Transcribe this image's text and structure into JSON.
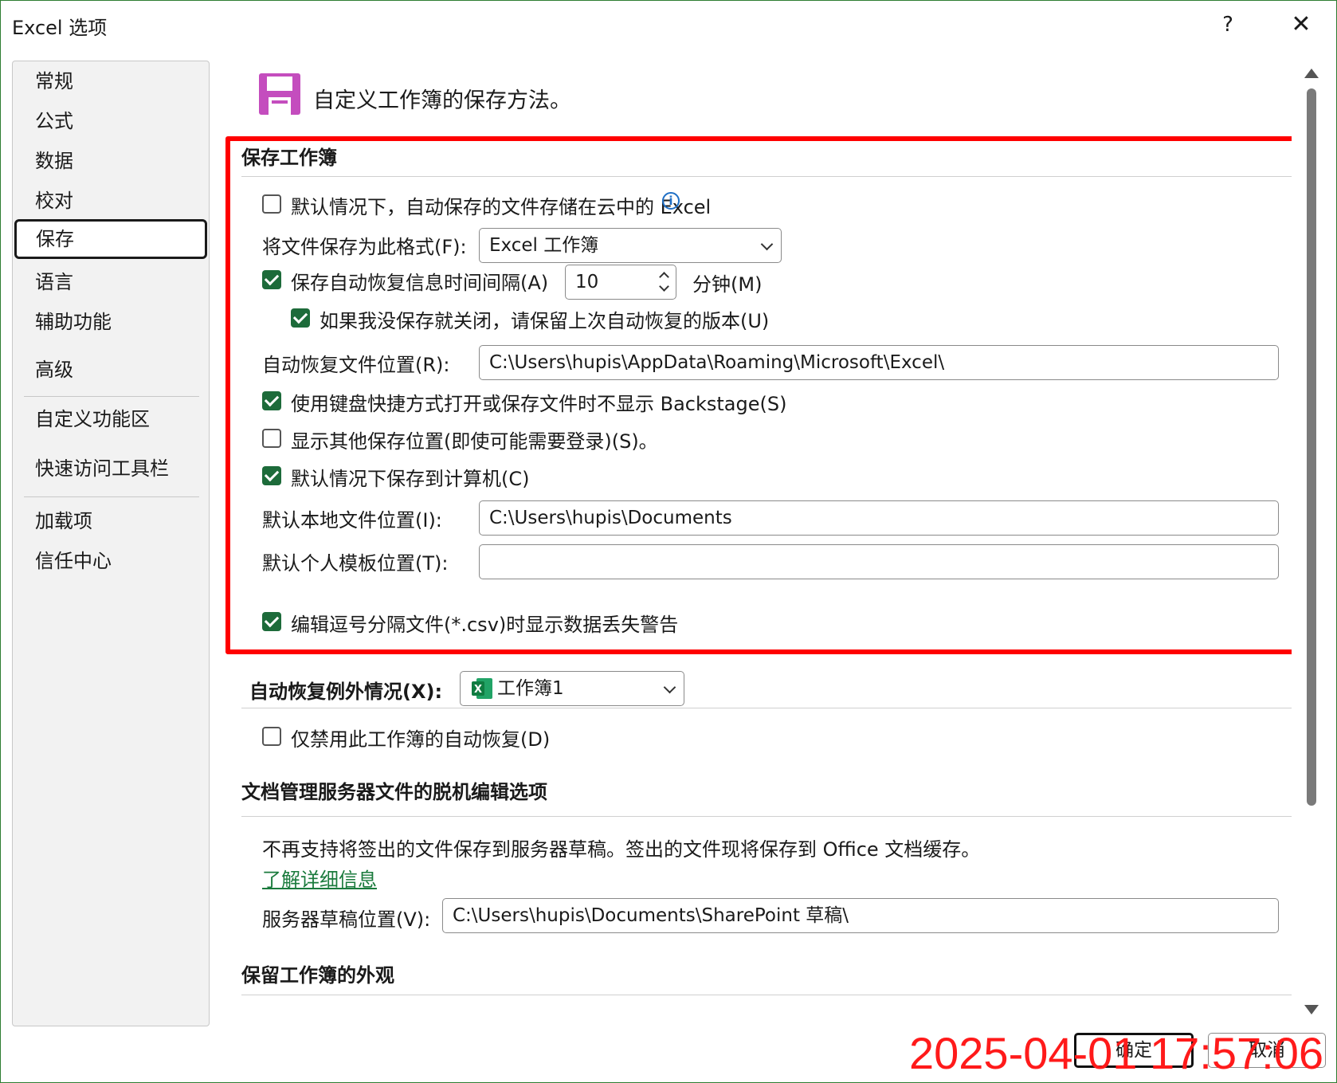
{
  "window": {
    "title": "Excel 选项",
    "help": "?",
    "close": "✕"
  },
  "nav": {
    "items": [
      {
        "label": "常规"
      },
      {
        "label": "公式"
      },
      {
        "label": "数据"
      },
      {
        "label": "校对"
      },
      {
        "label": "保存",
        "active": true
      },
      {
        "label": "语言"
      },
      {
        "label": "辅助功能"
      },
      {
        "label": "高级"
      },
      {
        "label": "自定义功能区"
      },
      {
        "label": "快速访问工具栏"
      },
      {
        "label": "加载项"
      },
      {
        "label": "信任中心"
      }
    ]
  },
  "header": {
    "text": "自定义工作簿的保存方法。"
  },
  "save_workbook": {
    "title": "保存工作簿",
    "cloud_default": {
      "label": "默认情况下，自动保存的文件存储在云中的 Excel",
      "checked": false
    },
    "format_label": "将文件保存为此格式(F):",
    "format_value": "Excel 工作簿",
    "autorecover": {
      "label": "保存自动恢复信息时间间隔(A)",
      "checked": true,
      "minutes": "10",
      "unit": "分钟(M)"
    },
    "keep_last": {
      "label": "如果我没保存就关闭，请保留上次自动恢复的版本(U)",
      "checked": true
    },
    "autorecover_location_label": "自动恢复文件位置(R):",
    "autorecover_location_value": "C:\\Users\\hupis\\AppData\\Roaming\\Microsoft\\Excel\\",
    "no_backstage": {
      "label": "使用键盘快捷方式打开或保存文件时不显示 Backstage(S)",
      "checked": true
    },
    "show_other": {
      "label": "显示其他保存位置(即使可能需要登录)(S)。",
      "checked": false
    },
    "save_to_computer": {
      "label": "默认情况下保存到计算机(C)",
      "checked": true
    },
    "local_location_label": "默认本地文件位置(I):",
    "local_location_value": "C:\\Users\\hupis\\Documents",
    "template_location_label": "默认个人模板位置(T):",
    "template_location_value": "",
    "csv_warning": {
      "label": "编辑逗号分隔文件(*.csv)时显示数据丢失警告",
      "checked": true
    }
  },
  "exceptions": {
    "title": "自动恢复例外情况(X):",
    "workbook": "工作簿1",
    "disable": {
      "label": "仅禁用此工作簿的自动恢复(D)",
      "checked": false
    }
  },
  "offline": {
    "title": "文档管理服务器文件的脱机编辑选项",
    "notice": "不再支持将签出的文件保存到服务器草稿。签出的文件现将保存到 Office 文档缓存。",
    "learn_more": "了解详细信息",
    "draft_label": "服务器草稿位置(V):",
    "draft_value": "C:\\Users\\hupis\\Documents\\SharePoint 草稿\\"
  },
  "appearance": {
    "title": "保留工作簿的外观"
  },
  "footer": {
    "ok": "确定",
    "cancel": "取消"
  },
  "overlay": {
    "timestamp": "2025-04-01 17:57:06",
    "color": "#ff1a1a"
  },
  "colors": {
    "checkbox": "#1d6b3a",
    "highlight": "#ff0000",
    "link": "#1a7a3c"
  }
}
